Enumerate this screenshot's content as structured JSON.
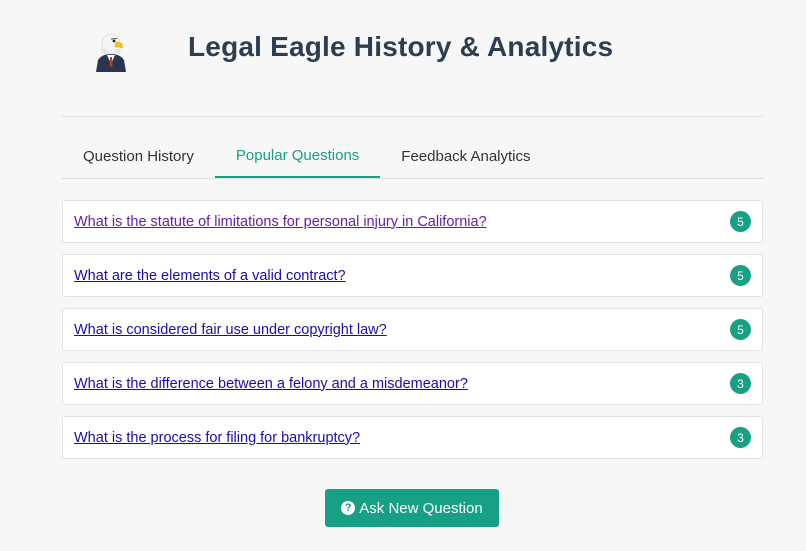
{
  "app": {
    "title": "Legal Eagle History & Analytics",
    "logo_icon": "eagle-lawyer-logo"
  },
  "tabs": [
    {
      "label": "Question History",
      "active": false
    },
    {
      "label": "Popular Questions",
      "active": true
    },
    {
      "label": "Feedback Analytics",
      "active": false
    }
  ],
  "questions": [
    {
      "text": "What is the statute of limitations for personal injury in California?",
      "count": "5",
      "visited": true
    },
    {
      "text": "What are the elements of a valid contract?",
      "count": "5",
      "visited": false
    },
    {
      "text": "What is considered fair use under copyright law?",
      "count": "5",
      "visited": false
    },
    {
      "text": "What is the difference between a felony and a misdemeanor?",
      "count": "3",
      "visited": false
    },
    {
      "text": "What is the process for filing for bankruptcy?",
      "count": "3",
      "visited": false
    }
  ],
  "ask_button": {
    "label": "Ask New Question",
    "icon": "question-circle-icon"
  },
  "colors": {
    "accent": "#16a085",
    "title": "#2c3e50",
    "link": "#1a0dab",
    "link_visited": "#681da8"
  }
}
